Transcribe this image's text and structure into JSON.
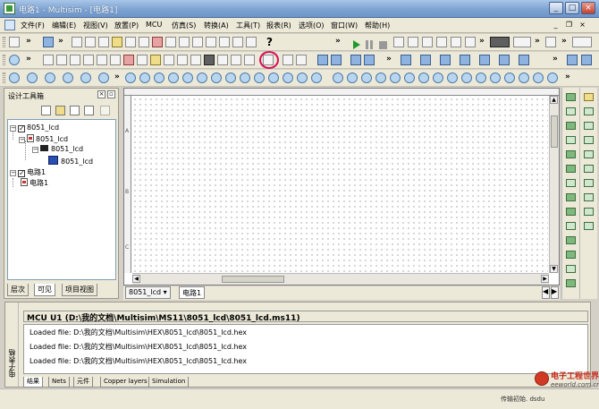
{
  "window": {
    "title": "电路1 - Multisim - [电路1]",
    "minimize": "_",
    "maximize": "□",
    "close": "×"
  },
  "menubar": {
    "items": [
      "文件(F)",
      "编辑(E)",
      "视图(V)",
      "放置(P)",
      "MCU",
      "仿真(S)",
      "转换(A)",
      "工具(T)",
      "报表(R)",
      "选项(O)",
      "窗口(W)",
      "帮助(H)"
    ],
    "mdi_minimize": "_",
    "mdi_restore": "❐",
    "mdi_close": "×"
  },
  "toolbar": {
    "help_glyph": "?",
    "overflow": "»",
    "play_icon": "play-icon",
    "pause_icon": "pause-icon",
    "stop_icon": "stop-icon",
    "highlight_color": "#d8105a"
  },
  "design_panel": {
    "title": "设计工具箱",
    "tree": [
      {
        "label": "8051_lcd",
        "type": "project"
      },
      {
        "label": "8051_lcd",
        "type": "design"
      },
      {
        "label": "8051_lcd",
        "type": "mcu"
      },
      {
        "label": "8051_lcd",
        "type": "board"
      },
      {
        "label": "电路1",
        "type": "project"
      },
      {
        "label": "电路1",
        "type": "design"
      }
    ],
    "tabs": [
      "层次",
      "可见",
      "项目视图"
    ],
    "active_tab": "层次"
  },
  "canvas": {
    "row_labels": [
      "A",
      "B",
      "C"
    ],
    "sheet_tabs": [
      "8051_lcd",
      "电路1"
    ],
    "active_sheet": "电路1"
  },
  "output": {
    "side_label": "电子表格",
    "header": "MCU U1 (D:\\我的文档\\Multisim\\MS11\\8051_lcd\\8051_lcd.ms11)",
    "lines": [
      "Loaded file: D:\\我的文档\\Multisim\\HEX\\8051_lcd\\8051_lcd.hex",
      "Loaded file: D:\\我的文档\\Multisim\\HEX\\8051_lcd\\8051_lcd.hex",
      "Loaded file: D:\\我的文档\\Multisim\\HEX\\8051_lcd\\8051_lcd.hex"
    ],
    "tabs": [
      "结果",
      "Nets",
      "元件",
      "Copper layers",
      "Simulation"
    ],
    "active_tab": "结果"
  },
  "statusbar": {
    "text": "传输初始. dsdu"
  },
  "watermark": {
    "title": "电子工程世界",
    "url": "eeworld.com.cn"
  }
}
